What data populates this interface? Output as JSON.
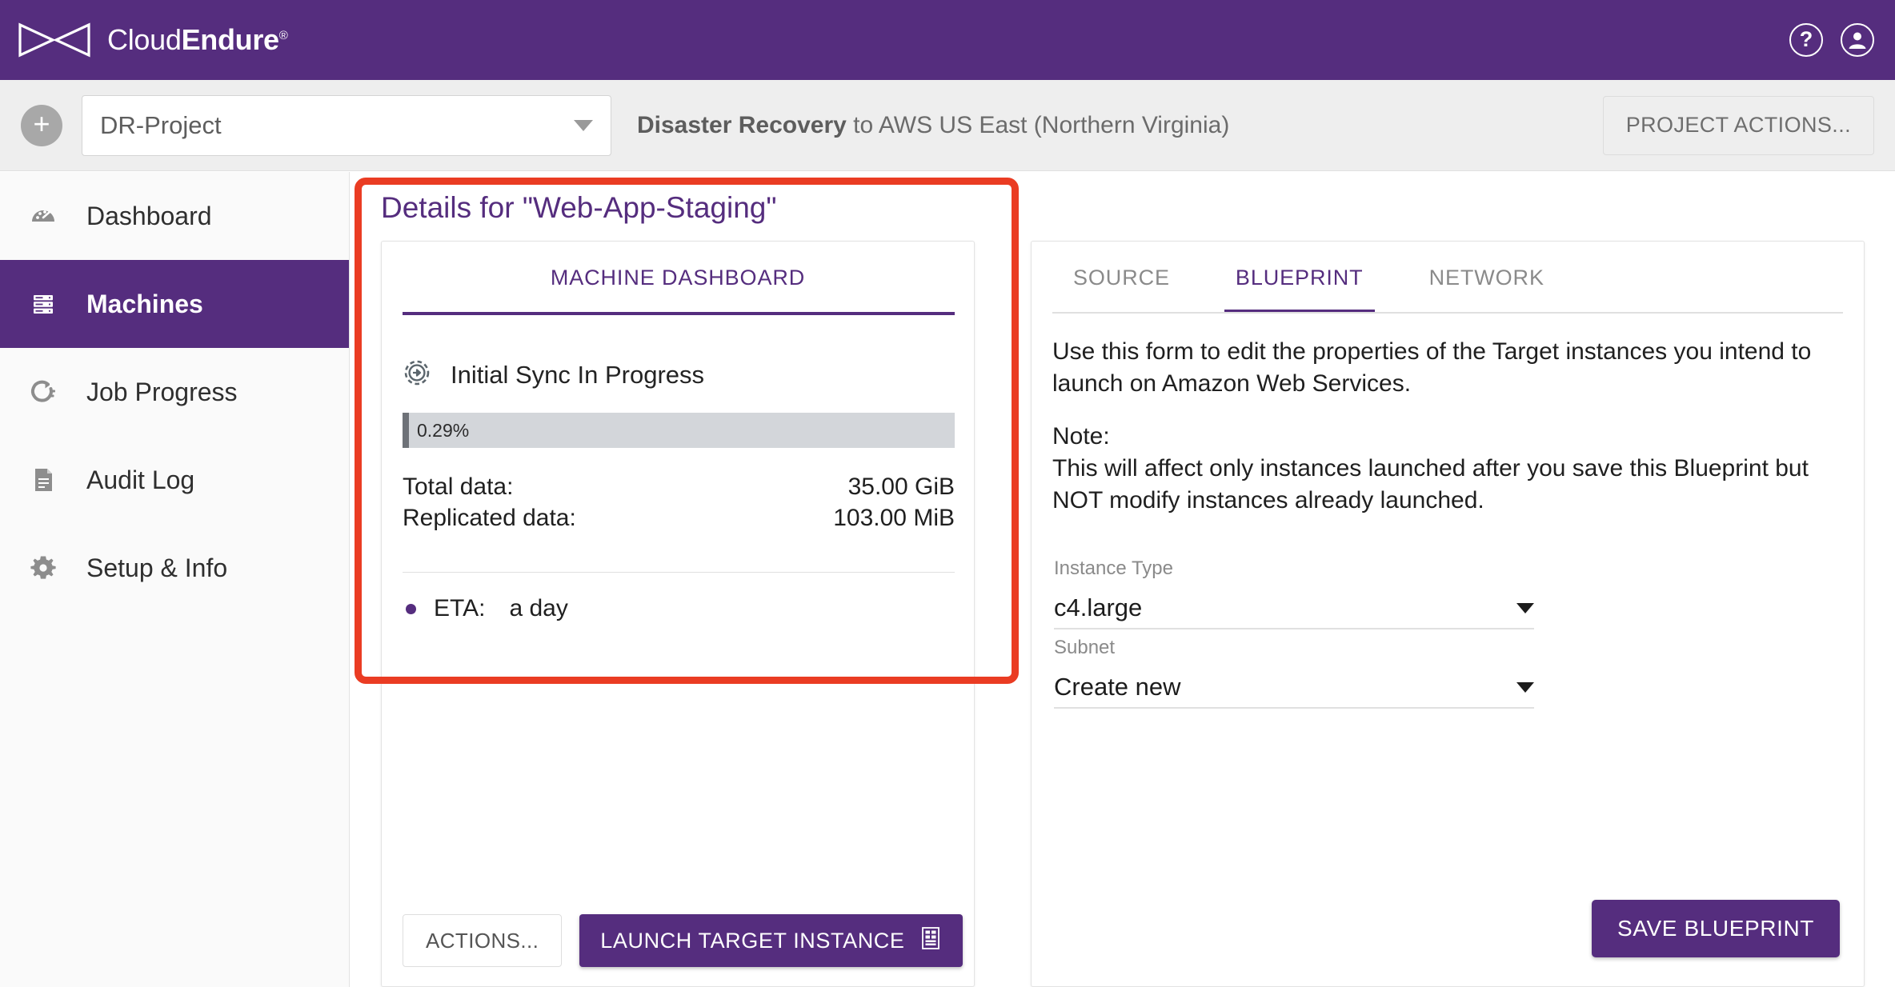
{
  "brand": {
    "name_light": "Cloud",
    "name_bold": "Endure",
    "registered": "®"
  },
  "topbar": {
    "help_icon": "question-mark-circle-icon",
    "account_icon": "user-circle-icon"
  },
  "projectbar": {
    "add_label": "+",
    "project_value": "DR-Project",
    "description_bold": "Disaster Recovery",
    "description_rest": " to AWS US East (Northern Virginia)",
    "project_actions_label": "PROJECT ACTIONS..."
  },
  "sidebar": {
    "items": [
      {
        "label": "Dashboard",
        "icon": "gauge-icon",
        "active": false
      },
      {
        "label": "Machines",
        "icon": "server-icon",
        "active": true
      },
      {
        "label": "Job Progress",
        "icon": "progress-circle-icon",
        "active": false
      },
      {
        "label": "Audit Log",
        "icon": "document-icon",
        "active": false
      },
      {
        "label": "Setup & Info",
        "icon": "gear-icon",
        "active": false
      }
    ]
  },
  "main": {
    "details_title": "Details for \"Web-App-Staging\"",
    "left_panel": {
      "tab_label": "MACHINE DASHBOARD",
      "status_icon": "sync-in-progress-icon",
      "status_text": "Initial Sync In Progress",
      "progress_percent_label": "0.29%",
      "progress_percent_value": 0.29,
      "rows": [
        {
          "label": "Total data:",
          "value": "35.00 GiB"
        },
        {
          "label": "Replicated data:",
          "value": "103.00 MiB"
        }
      ],
      "eta_label": "ETA:",
      "eta_value": "a day",
      "actions_button": "ACTIONS...",
      "launch_button": "LAUNCH TARGET INSTANCE",
      "launch_button_icon": "server-rack-icon"
    },
    "right_panel": {
      "tabs": [
        {
          "label": "SOURCE",
          "active": false
        },
        {
          "label": "BLUEPRINT",
          "active": true
        },
        {
          "label": "NETWORK",
          "active": false
        }
      ],
      "description_line1": "Use this form to edit the properties of the Target instances you intend to launch on Amazon Web Services.",
      "note_heading": "Note:",
      "note_body": "This will affect only instances launched after you save this Blueprint but NOT modify instances already launched.",
      "fields": [
        {
          "label": "Instance Type",
          "value": "c4.large"
        },
        {
          "label": "Subnet",
          "value": "Create new"
        }
      ],
      "save_button": "SAVE BLUEPRINT"
    },
    "highlight": {
      "color": "#ea3c23"
    }
  },
  "colors": {
    "brand_purple": "#552d7e",
    "highlight_red": "#ea3c23",
    "bar_grey": "#eeeeee"
  }
}
